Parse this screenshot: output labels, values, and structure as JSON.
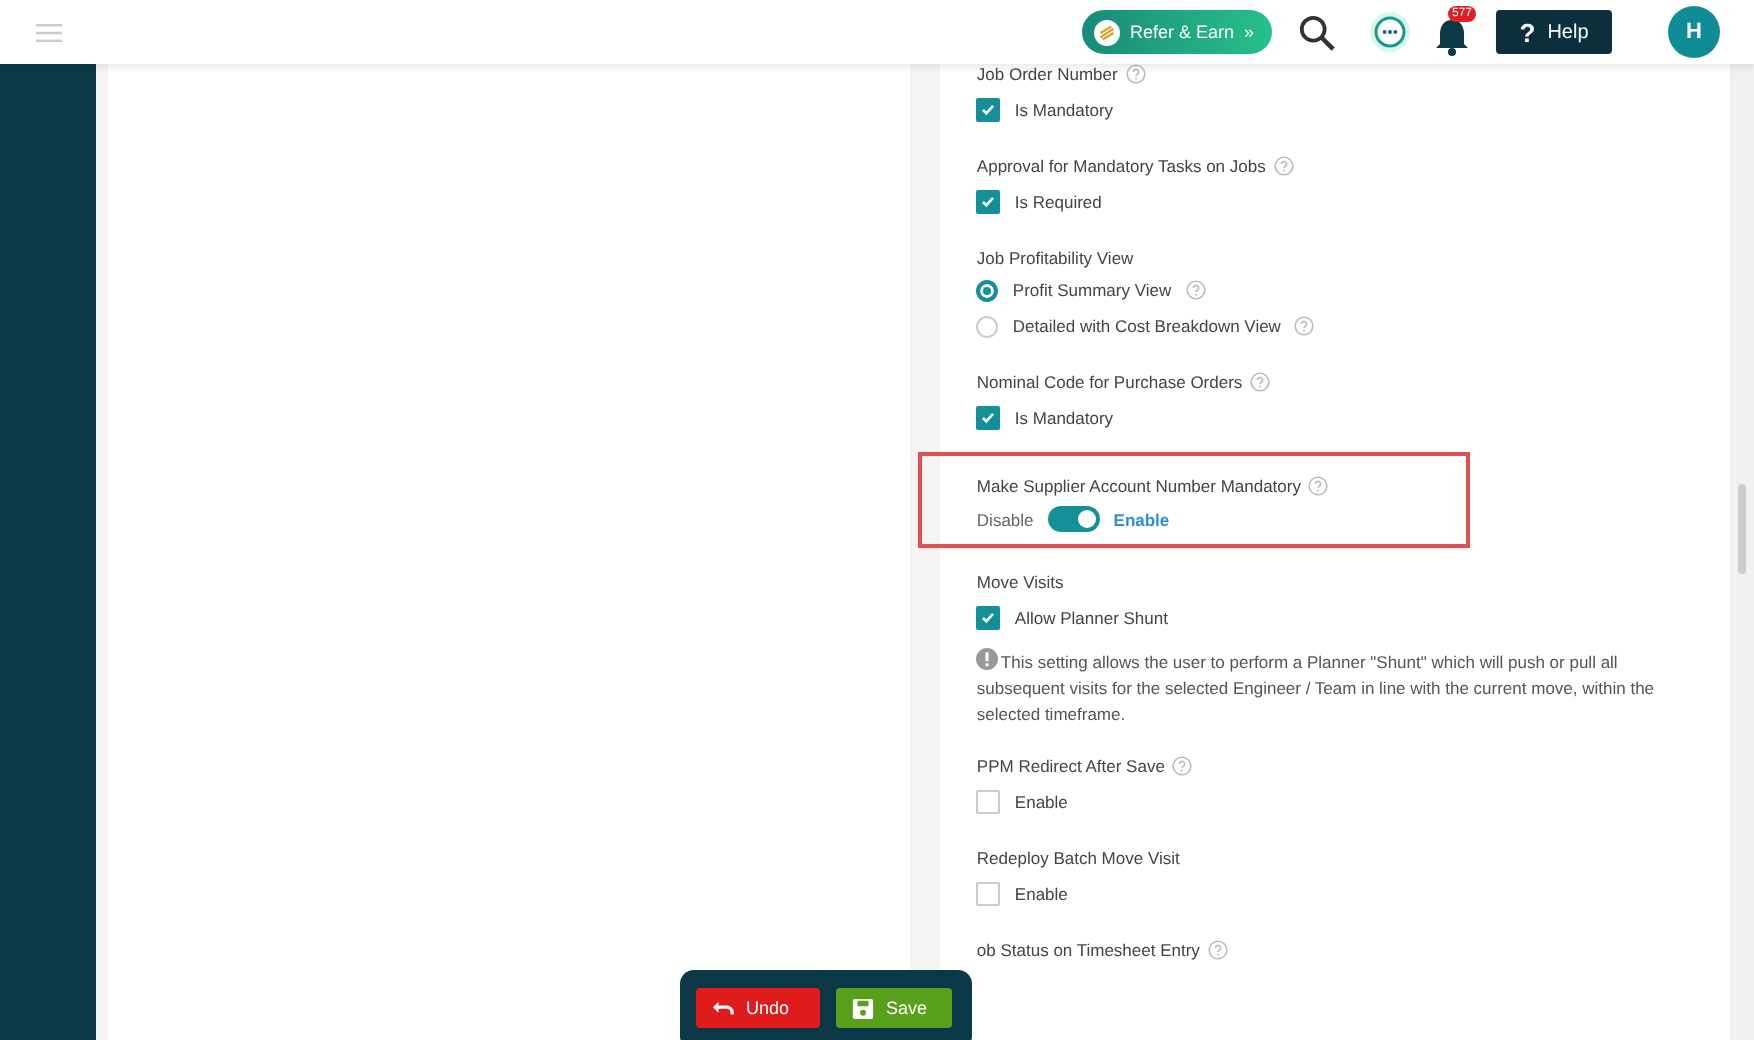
{
  "header": {
    "refer_button": "Refer & Earn",
    "refer_chevron": "»",
    "notification_count": "577",
    "help_glyph": "?",
    "help_button": "Help",
    "avatar_initial": "H"
  },
  "settings": [
    {
      "title": "Job Order Number",
      "help": true,
      "highlighted": false,
      "kind": "checkbox",
      "options": [
        {
          "label": "Is Mandatory",
          "checked": true
        }
      ]
    },
    {
      "title": "Approval for Mandatory Tasks on Jobs",
      "help": true,
      "highlighted": false,
      "kind": "checkbox",
      "options": [
        {
          "label": "Is Required",
          "checked": true
        }
      ]
    },
    {
      "title": "Job Profitability View",
      "help": false,
      "highlighted": false,
      "kind": "radio",
      "options": [
        {
          "label": "Profit Summary View",
          "selected": true,
          "help": true
        },
        {
          "label": "Detailed with Cost Breakdown View",
          "selected": false,
          "help": true
        }
      ]
    },
    {
      "title": "Nominal Code for Purchase Orders",
      "help": true,
      "highlighted": false,
      "kind": "checkbox",
      "options": [
        {
          "label": "Is Mandatory",
          "checked": true
        }
      ]
    },
    {
      "title": "Make Supplier Account Number Mandatory",
      "help": true,
      "highlighted": true,
      "kind": "toggle",
      "off_label": "Disable",
      "on_label": "Enable",
      "on": true
    },
    {
      "title": "Move Visits",
      "help": false,
      "highlighted": false,
      "kind": "checkbox",
      "options": [
        {
          "label": "Allow Planner Shunt",
          "checked": true
        }
      ],
      "note": "This setting allows the user to perform a Planner \"Shunt\" which will push or pull all subsequent visits for the selected Engineer / Team in line with the current move, within the selected timeframe."
    },
    {
      "title": "PPM Redirect After Save",
      "help": true,
      "highlighted": false,
      "kind": "checkbox",
      "options": [
        {
          "label": "Enable",
          "checked": false
        }
      ]
    },
    {
      "title": "Redeploy Batch Move Visit",
      "help": false,
      "highlighted": false,
      "kind": "checkbox",
      "options": [
        {
          "label": "Enable",
          "checked": false
        }
      ]
    },
    {
      "title": "ob Status on Timesheet Entry",
      "help": true,
      "highlighted": false,
      "kind": "none"
    }
  ],
  "action_bar": {
    "undo_button": "Undo",
    "save_button": "Save"
  }
}
